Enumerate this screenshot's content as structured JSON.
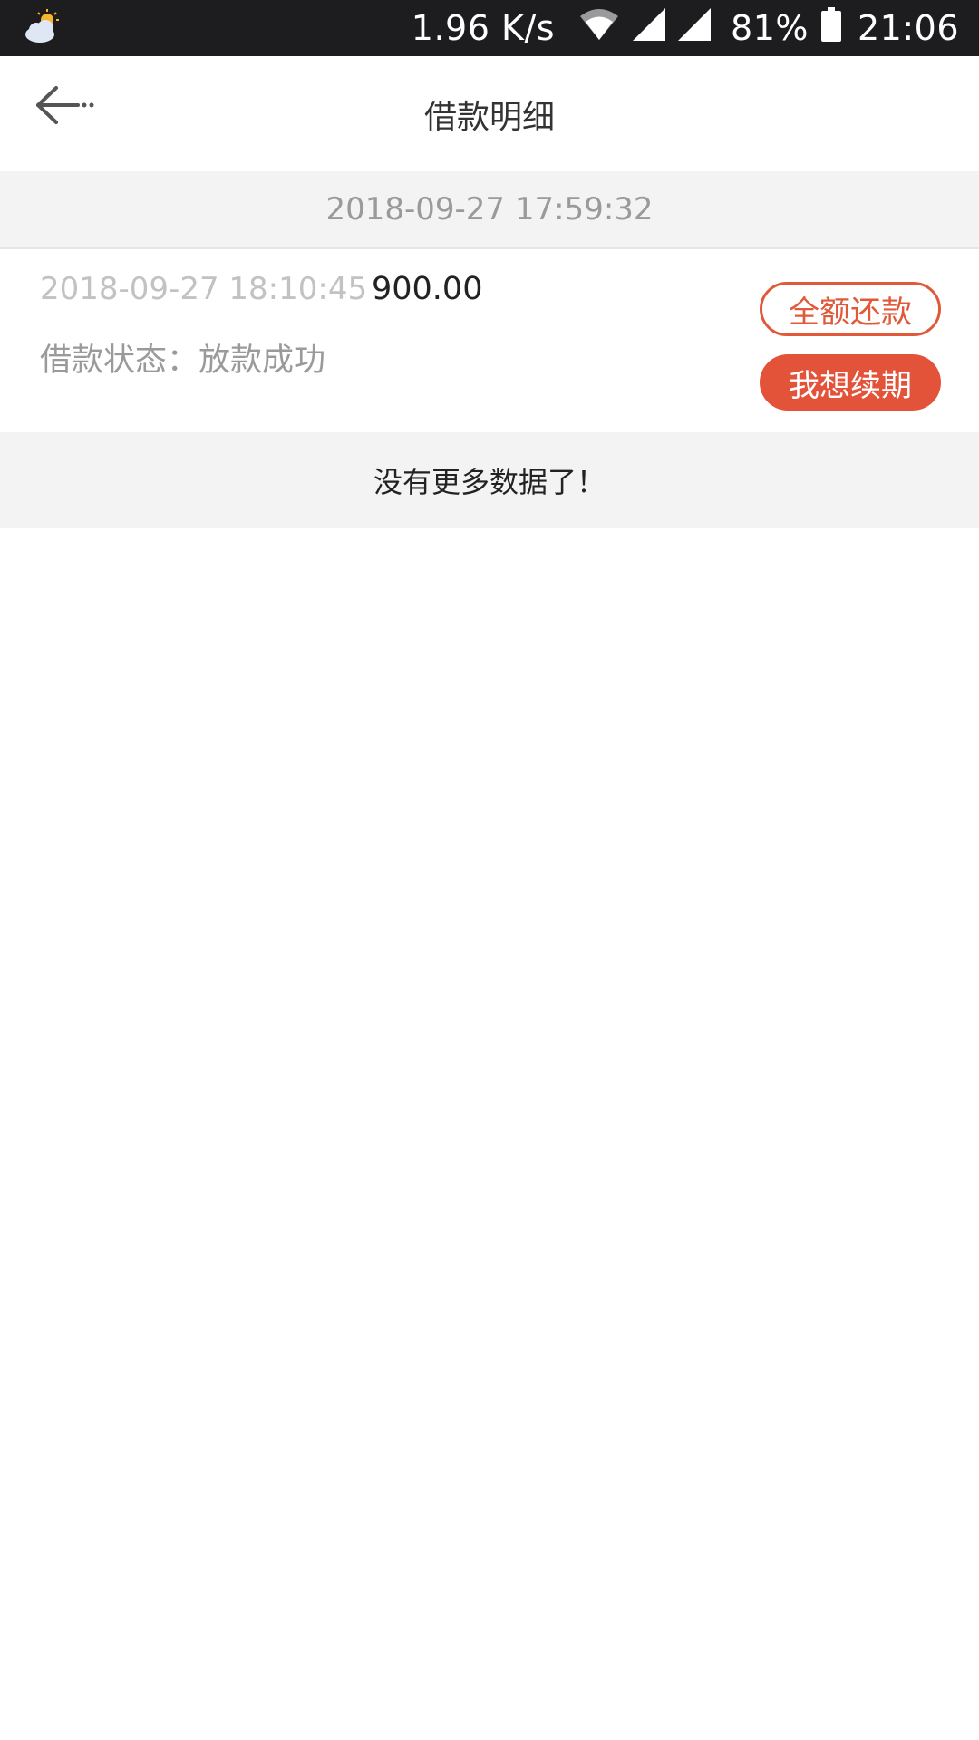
{
  "status_bar": {
    "net_speed": "1.96 K/s",
    "battery": "81%",
    "time": "21:06",
    "icons": [
      "weather-icon",
      "wifi-icon",
      "signal-icon",
      "signal-icon",
      "battery-icon"
    ]
  },
  "header": {
    "title": "借款明细",
    "back_icon": "back-arrow-icon"
  },
  "group": {
    "date": "2018-09-27 17:59:32"
  },
  "record": {
    "time": "2018-09-27 18:10:45",
    "amount": "900.00",
    "status": "借款状态：放款成功",
    "repay_label": "全额还款",
    "renew_label": "我想续期"
  },
  "footer": {
    "no_more": "没有更多数据了！"
  },
  "colors": {
    "accent": "#e3533a",
    "status_bar_bg": "#1d1d1f",
    "divider_bg": "#f3f3f3"
  }
}
